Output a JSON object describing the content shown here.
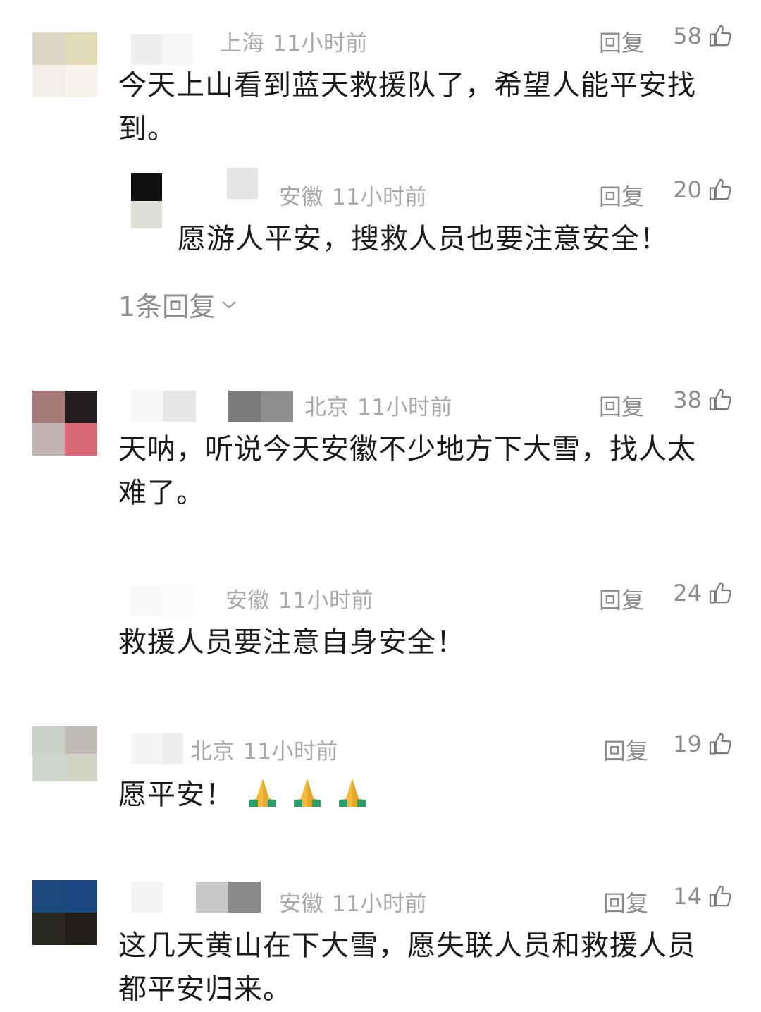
{
  "comments": [
    {
      "location": "上海",
      "time": "11小时前",
      "reply_label": "回复",
      "likes": "58",
      "text": "今天上山看到蓝天救援队了，希望人能平安找到。",
      "avatar_colors": [
        "#ddd6c4",
        "#e3dcba",
        "#f4f0e6",
        "#f7f5ec"
      ],
      "name_blur_colors": [
        "#f1f1f1",
        "#f7f7f7",
        "#ffffff",
        "#ffffff"
      ],
      "reply": {
        "location": "安徽",
        "time": "11小时前",
        "reply_label": "回复",
        "likes": "20",
        "text": "愿游人平安，搜救人员也要注意安全！",
        "avatar_colors": [
          "#111111",
          "#151515",
          "#dcdfd6",
          "#e1e4dc"
        ],
        "name_blur_colors": [
          "#e3e3e3",
          "#f2f2f2"
        ]
      },
      "expand_label": "1条回复"
    },
    {
      "location": "北京",
      "time": "11小时前",
      "reply_label": "回复",
      "likes": "38",
      "text": "天呐，听说今天安徽不少地方下大雪，找人太难了。",
      "avatar_colors": [
        "#a57a78",
        "#231f1e",
        "#c1b2b4",
        "#db6a78"
      ],
      "name_blur_colors": [
        "#f6f6f6",
        "#e6e6e6",
        "#ffffff",
        "#7c7c7c",
        "#8e8e8e"
      ]
    },
    {
      "location": "安徽",
      "time": "11小时前",
      "reply_label": "回复",
      "likes": "24",
      "text": "救援人员要注意自身安全！",
      "avatar_colors": [
        "#ffffff",
        "#ffffff",
        "#ffffff",
        "#ffffff"
      ],
      "name_blur_colors": [
        "#f8f8f8",
        "#f3f3f3"
      ]
    },
    {
      "location": "北京",
      "time": "11小时前",
      "reply_label": "回复",
      "likes": "19",
      "text": "愿平安！",
      "emoji": "🙏🙏🙏",
      "avatar_colors": [
        "#c9d3c8",
        "#c1bbb6",
        "#cfd6cd",
        "#d2d3c5"
      ],
      "name_blur_colors": [
        "#f5f5f5",
        "#eeeeee"
      ]
    },
    {
      "location": "安徽",
      "time": "11小时前",
      "reply_label": "回复",
      "likes": "14",
      "text": "这几天黄山在下大雪，愿失联人员和救援人员都平安归来。",
      "avatar_colors": [
        "#1d4a7e",
        "#1a477f",
        "#2a2920",
        "#231d19"
      ],
      "name_blur_colors": [
        "#f4f4f4",
        "#ffffff",
        "#c8c8c8",
        "#8a8a8a"
      ]
    }
  ]
}
